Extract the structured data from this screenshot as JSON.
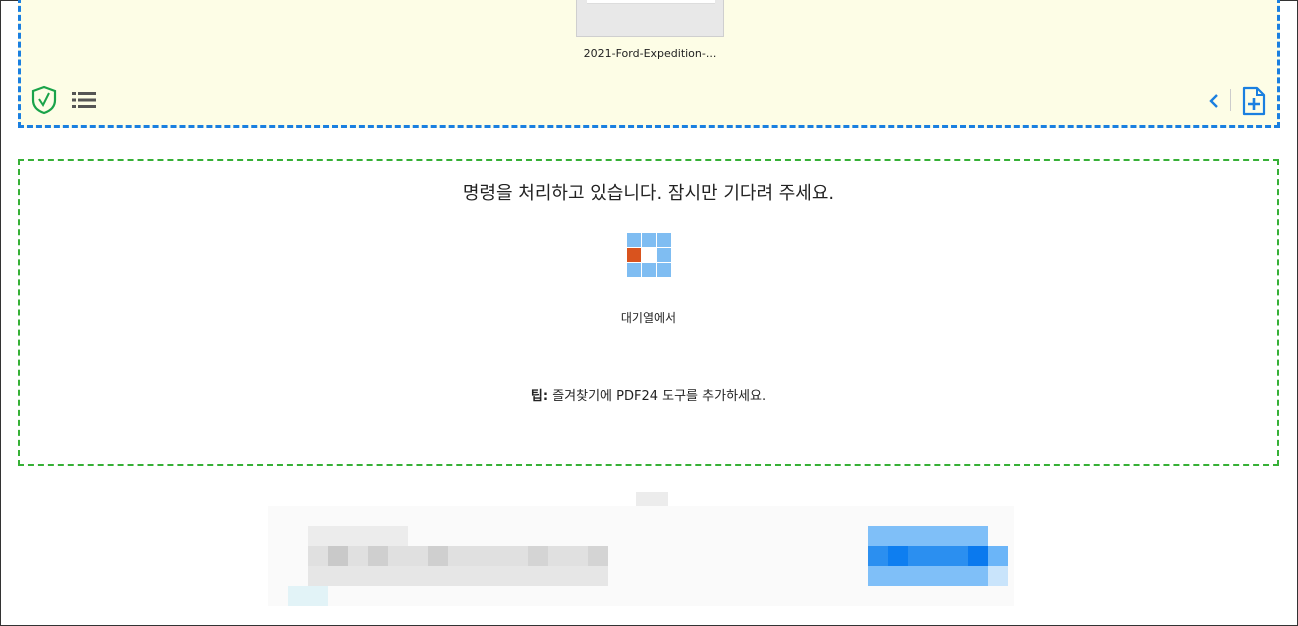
{
  "upload": {
    "file_name": "2021-Ford-Expedition-...",
    "icons": {
      "shield": "shield-check-icon",
      "list": "list-icon",
      "chevron": "chevron-left-icon",
      "add": "add-file-icon"
    },
    "colors": {
      "border": "#1a7fe0",
      "background": "#fdfde6",
      "shield": "#1aa34a"
    }
  },
  "processing": {
    "message": "명령을 처리하고 있습니다. 잠시만 기다려 주세요.",
    "status": "대기열에서",
    "tip_label": "팁:",
    "tip_text": "즐겨찾기에 PDF24 도구를 추가하세요.",
    "colors": {
      "border": "#36b036",
      "spinner": "#7fbdf2",
      "spinner_active": "#d9531e"
    }
  }
}
